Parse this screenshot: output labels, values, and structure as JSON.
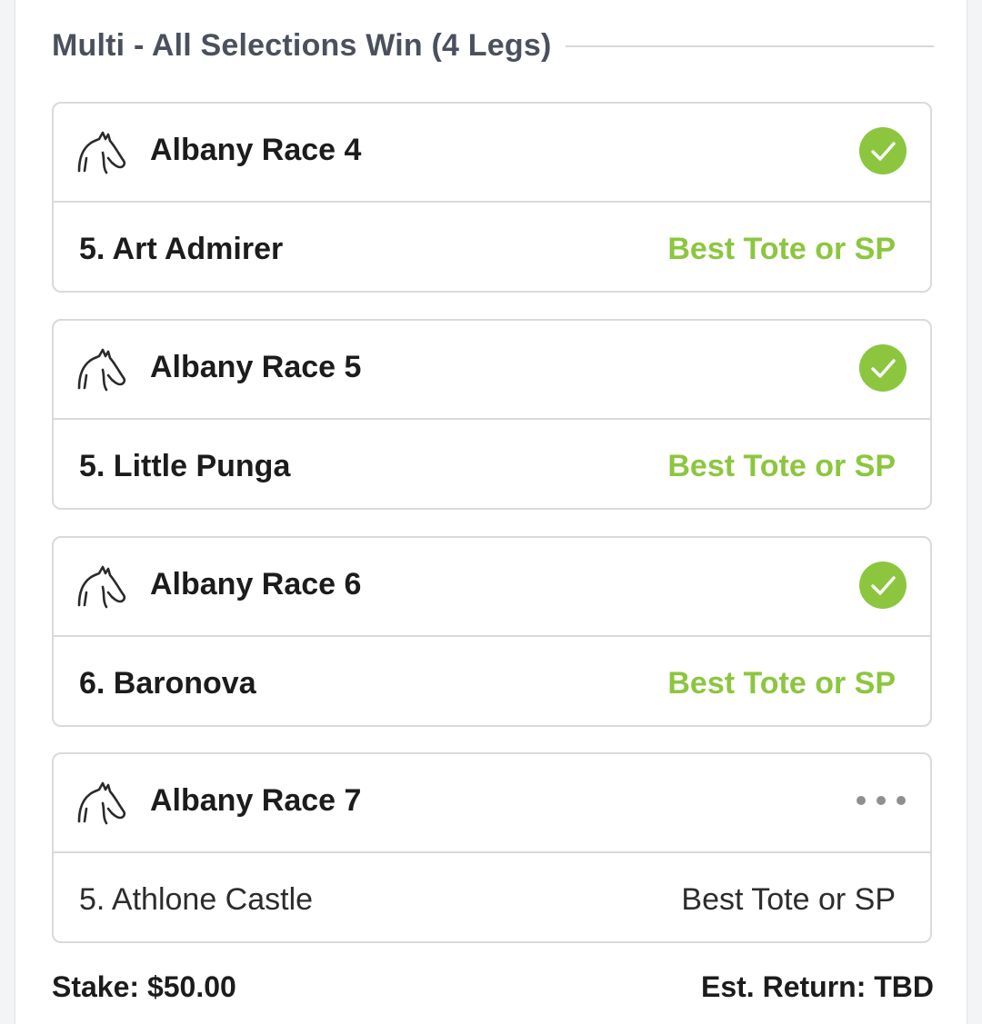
{
  "bet": {
    "title": "Multi - All Selections Win (4 Legs)",
    "stake_label": "Stake: $50.00",
    "return_label": "Est. Return: TBD"
  },
  "legs": [
    {
      "race": "Albany Race 4",
      "selection": "5. Art Admirer",
      "bet_type": "Best Tote or SP",
      "status": "won"
    },
    {
      "race": "Albany Race 5",
      "selection": "5. Little Punga",
      "bet_type": "Best Tote or SP",
      "status": "won"
    },
    {
      "race": "Albany Race 6",
      "selection": "6. Baronova",
      "bet_type": "Best Tote or SP",
      "status": "won"
    },
    {
      "race": "Albany Race 7",
      "selection": "5. Athlone Castle",
      "bet_type": "Best Tote or SP",
      "status": "pending"
    }
  ],
  "colors": {
    "won": "#8cc63f",
    "pending_dots": "#8f8f8f",
    "title": "#4a515d"
  },
  "icons": {
    "race": "horse-head-icon",
    "won": "check-circle-icon",
    "pending": "ellipsis-icon"
  }
}
